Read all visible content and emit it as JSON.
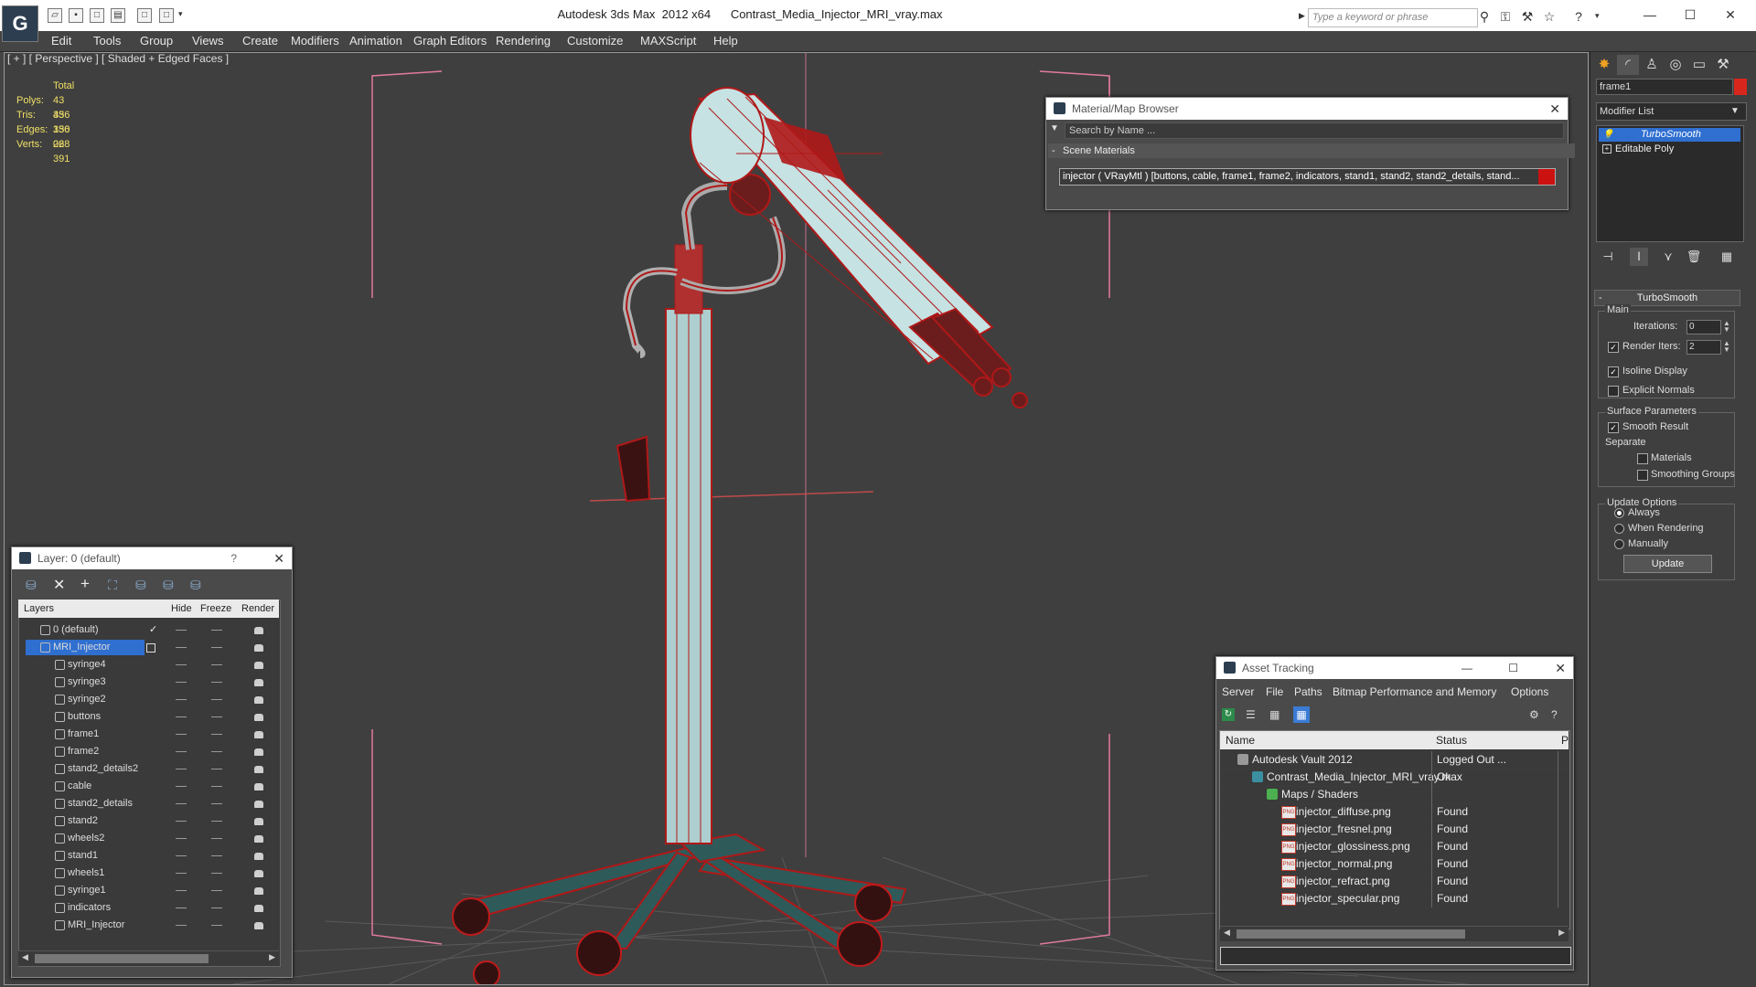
{
  "window": {
    "title": "Autodesk 3ds Max  2012 x64      Contrast_Media_Injector_MRI_vray.max",
    "search_placeholder": "Type a keyword or phrase",
    "minimize": "—",
    "maximize": "☐",
    "close": "✕"
  },
  "menu": [
    "Edit",
    "Tools",
    "Group",
    "Views",
    "Create",
    "Modifiers",
    "Animation",
    "Graph Editors",
    "Rendering",
    "Customize",
    "MAXScript",
    "Help"
  ],
  "viewport": {
    "label": "[ + ] [ Perspective ] [ Shaded + Edged Faces ]",
    "stats": {
      "header": "Total",
      "rows": [
        {
          "label": "Polys:",
          "value": "43 356"
        },
        {
          "label": "Tris:",
          "value": "43 356"
        },
        {
          "label": "Edges:",
          "value": "130 068"
        },
        {
          "label": "Verts:",
          "value": "22 391"
        }
      ]
    }
  },
  "command_panel": {
    "object_name": "frame1",
    "object_color": "#d8261c",
    "modifier_list": "Modifier List",
    "stack": [
      "TurboSmooth",
      "Editable Poly"
    ],
    "turbosmooth": {
      "title": "TurboSmooth",
      "main_label": "Main",
      "iterations_label": "Iterations:",
      "iterations_value": "0",
      "render_iters_label": "Render Iters:",
      "render_iters_value": "2",
      "render_iters_checked": true,
      "isoline_label": "Isoline Display",
      "isoline_checked": true,
      "explicit_normals_label": "Explicit Normals",
      "explicit_normals_checked": false,
      "surface_params_label": "Surface Parameters",
      "smooth_result_label": "Smooth Result",
      "smooth_result_checked": true,
      "separate_label": "Separate",
      "materials_label": "Materials",
      "smoothing_groups_label": "Smoothing Groups",
      "update_options_label": "Update Options",
      "always_label": "Always",
      "when_rendering_label": "When Rendering",
      "manually_label": "Manually",
      "update_button": "Update"
    }
  },
  "material_browser": {
    "title": "Material/Map Browser",
    "search_placeholder": "Search by Name ...",
    "section": "Scene Materials",
    "material": "injector  ( VRayMtl )  [buttons, cable, frame1, frame2, indicators, stand1, stand2, stand2_details, stand..."
  },
  "layer_manager": {
    "title": "Layer: 0 (default)",
    "help": "?",
    "columns": {
      "layers": "Layers",
      "hide": "Hide",
      "freeze": "Freeze",
      "render": "Render"
    },
    "layers": [
      {
        "name": "0 (default)",
        "type": "layer",
        "current": true
      },
      {
        "name": "MRI_Injector",
        "type": "layer",
        "selected": true
      },
      {
        "name": "syringe4",
        "type": "object"
      },
      {
        "name": "syringe3",
        "type": "object"
      },
      {
        "name": "syringe2",
        "type": "object"
      },
      {
        "name": "buttons",
        "type": "object"
      },
      {
        "name": "frame1",
        "type": "object"
      },
      {
        "name": "frame2",
        "type": "object"
      },
      {
        "name": "stand2_details2",
        "type": "object"
      },
      {
        "name": "cable",
        "type": "object"
      },
      {
        "name": "stand2_details",
        "type": "object"
      },
      {
        "name": "stand2",
        "type": "object"
      },
      {
        "name": "wheels2",
        "type": "object"
      },
      {
        "name": "stand1",
        "type": "object"
      },
      {
        "name": "wheels1",
        "type": "object"
      },
      {
        "name": "syringe1",
        "type": "object"
      },
      {
        "name": "indicators",
        "type": "object"
      },
      {
        "name": "MRI_Injector",
        "type": "object"
      }
    ]
  },
  "asset_tracking": {
    "title": "Asset Tracking",
    "menu": [
      "Server",
      "File",
      "Paths",
      "Bitmap Performance and Memory",
      "Options"
    ],
    "columns": {
      "name": "Name",
      "status": "Status",
      "p": "P"
    },
    "rows": [
      {
        "name": "Autodesk Vault 2012",
        "status": "Logged Out ...",
        "indent": 0,
        "icon": "vault-icon"
      },
      {
        "name": "Contrast_Media_Injector_MRI_vray.max",
        "status": "Ok",
        "indent": 1,
        "icon": "max-file-icon"
      },
      {
        "name": "Maps / Shaders",
        "status": "",
        "indent": 2,
        "icon": "maps-icon"
      },
      {
        "name": "injector_diffuse.png",
        "status": "Found",
        "indent": 3,
        "icon": "png-icon"
      },
      {
        "name": "injector_fresnel.png",
        "status": "Found",
        "indent": 3,
        "icon": "png-icon"
      },
      {
        "name": "injector_glossiness.png",
        "status": "Found",
        "indent": 3,
        "icon": "png-icon"
      },
      {
        "name": "injector_normal.png",
        "status": "Found",
        "indent": 3,
        "icon": "png-icon"
      },
      {
        "name": "injector_refract.png",
        "status": "Found",
        "indent": 3,
        "icon": "png-icon"
      },
      {
        "name": "injector_specular.png",
        "status": "Found",
        "indent": 3,
        "icon": "png-icon"
      }
    ]
  }
}
